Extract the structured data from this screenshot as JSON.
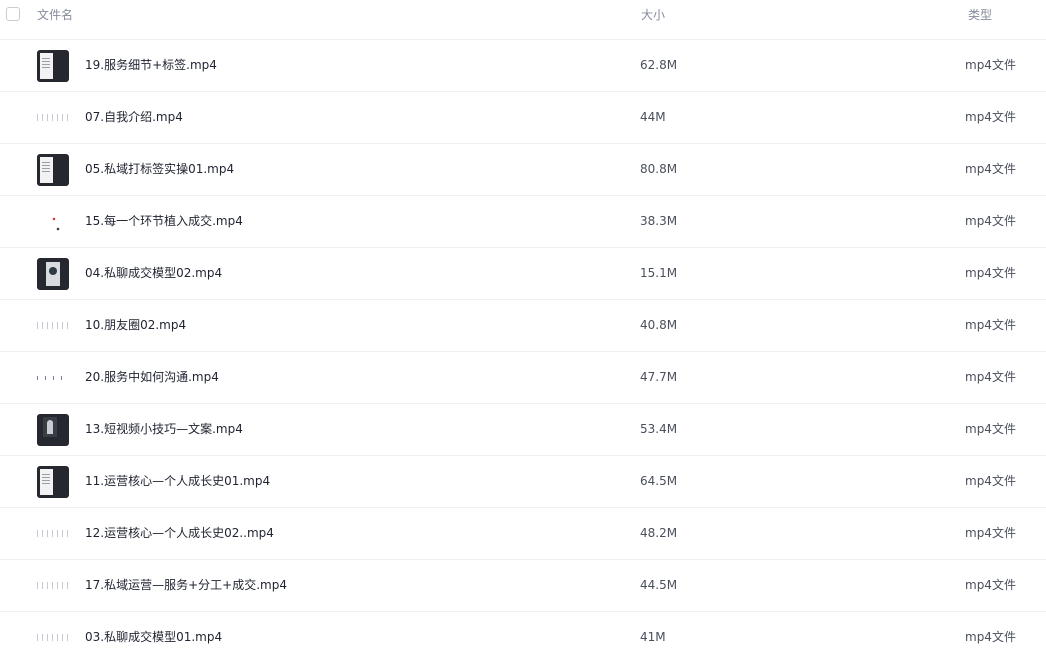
{
  "header": {
    "name": "文件名",
    "size": "大小",
    "type": "类型"
  },
  "files": [
    {
      "name": "19.服务细节+标签.mp4",
      "size": "62.8M",
      "type": "mp4文件",
      "thumb": "dark-screen"
    },
    {
      "name": "07.自我介绍.mp4",
      "size": "44M",
      "type": "mp4文件",
      "thumb": "light-dots"
    },
    {
      "name": "05.私域打标签实操01.mp4",
      "size": "80.8M",
      "type": "mp4文件",
      "thumb": "dark-screen"
    },
    {
      "name": "15.每一个环节植入成交.mp4",
      "size": "38.3M",
      "type": "mp4文件",
      "thumb": "light-sparse"
    },
    {
      "name": "04.私聊成交模型02.mp4",
      "size": "15.1M",
      "type": "mp4文件",
      "thumb": "dark-photo"
    },
    {
      "name": "10.朋友圈02.mp4",
      "size": "40.8M",
      "type": "mp4文件",
      "thumb": "light-dots"
    },
    {
      "name": "20.服务中如何沟通.mp4",
      "size": "47.7M",
      "type": "mp4文件",
      "thumb": "light-dots2"
    },
    {
      "name": "13.短视频小技巧—文案.mp4",
      "size": "53.4M",
      "type": "mp4文件",
      "thumb": "dark-figure"
    },
    {
      "name": "11.运营核心—个人成长史01.mp4",
      "size": "64.5M",
      "type": "mp4文件",
      "thumb": "dark-screen"
    },
    {
      "name": "12.运营核心—个人成长史02..mp4",
      "size": "48.2M",
      "type": "mp4文件",
      "thumb": "light-dots"
    },
    {
      "name": "17.私域运营—服务+分工+成交.mp4",
      "size": "44.5M",
      "type": "mp4文件",
      "thumb": "light-dots"
    },
    {
      "name": "03.私聊成交模型01.mp4",
      "size": "41M",
      "type": "mp4文件",
      "thumb": "light-dots"
    }
  ]
}
